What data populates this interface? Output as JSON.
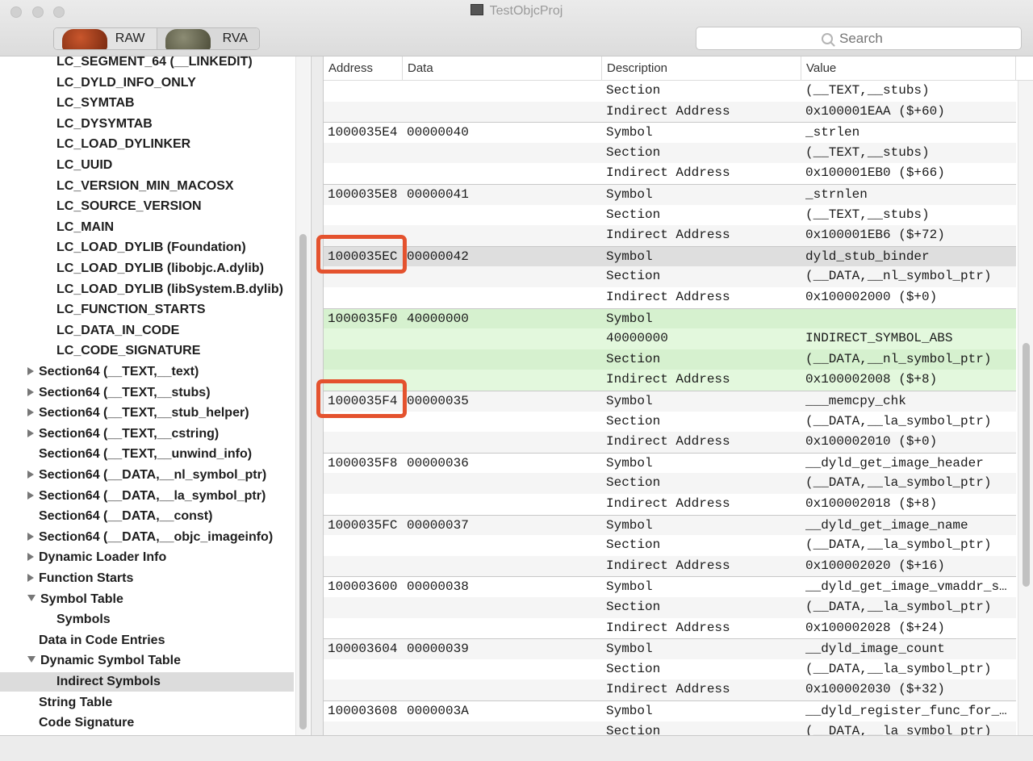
{
  "window": {
    "title": "TestObjcProj"
  },
  "toolbar": {
    "raw_label": "RAW",
    "rva_label": "RVA",
    "search_placeholder": "Search"
  },
  "sidebar": {
    "items": [
      {
        "label": "LC_SEGMENT_64 (__LINKEDIT)",
        "level": 2,
        "expand": "none"
      },
      {
        "label": "LC_DYLD_INFO_ONLY",
        "level": 2,
        "expand": "none"
      },
      {
        "label": "LC_SYMTAB",
        "level": 2,
        "expand": "none"
      },
      {
        "label": "LC_DYSYMTAB",
        "level": 2,
        "expand": "none"
      },
      {
        "label": "LC_LOAD_DYLINKER",
        "level": 2,
        "expand": "none"
      },
      {
        "label": "LC_UUID",
        "level": 2,
        "expand": "none"
      },
      {
        "label": "LC_VERSION_MIN_MACOSX",
        "level": 2,
        "expand": "none"
      },
      {
        "label": "LC_SOURCE_VERSION",
        "level": 2,
        "expand": "none"
      },
      {
        "label": "LC_MAIN",
        "level": 2,
        "expand": "none"
      },
      {
        "label": "LC_LOAD_DYLIB (Foundation)",
        "level": 2,
        "expand": "none"
      },
      {
        "label": "LC_LOAD_DYLIB (libobjc.A.dylib)",
        "level": 2,
        "expand": "none"
      },
      {
        "label": "LC_LOAD_DYLIB (libSystem.B.dylib)",
        "level": 2,
        "expand": "none"
      },
      {
        "label": "LC_FUNCTION_STARTS",
        "level": 2,
        "expand": "none"
      },
      {
        "label": "LC_DATA_IN_CODE",
        "level": 2,
        "expand": "none"
      },
      {
        "label": "LC_CODE_SIGNATURE",
        "level": 2,
        "expand": "none"
      },
      {
        "label": "Section64 (__TEXT,__text)",
        "level": 1,
        "expand": "closed"
      },
      {
        "label": "Section64 (__TEXT,__stubs)",
        "level": 1,
        "expand": "closed"
      },
      {
        "label": "Section64 (__TEXT,__stub_helper)",
        "level": 1,
        "expand": "closed"
      },
      {
        "label": "Section64 (__TEXT,__cstring)",
        "level": 1,
        "expand": "closed"
      },
      {
        "label": "Section64 (__TEXT,__unwind_info)",
        "level": 1,
        "expand": "none"
      },
      {
        "label": "Section64 (__DATA,__nl_symbol_ptr)",
        "level": 1,
        "expand": "closed"
      },
      {
        "label": "Section64 (__DATA,__la_symbol_ptr)",
        "level": 1,
        "expand": "closed"
      },
      {
        "label": "Section64 (__DATA,__const)",
        "level": 1,
        "expand": "none"
      },
      {
        "label": "Section64 (__DATA,__objc_imageinfo)",
        "level": 1,
        "expand": "closed"
      },
      {
        "label": "Dynamic Loader Info",
        "level": 1,
        "expand": "closed"
      },
      {
        "label": "Function Starts",
        "level": 1,
        "expand": "closed"
      },
      {
        "label": "Symbol Table",
        "level": 1,
        "expand": "open"
      },
      {
        "label": "Symbols",
        "level": 2,
        "expand": "none"
      },
      {
        "label": "Data in Code Entries",
        "level": 1,
        "expand": "none"
      },
      {
        "label": "Dynamic Symbol Table",
        "level": 1,
        "expand": "open"
      },
      {
        "label": "Indirect Symbols",
        "level": 2,
        "expand": "none",
        "selected": true
      },
      {
        "label": "String Table",
        "level": 1,
        "expand": "none"
      },
      {
        "label": "Code Signature",
        "level": 1,
        "expand": "none"
      }
    ]
  },
  "table": {
    "columns": [
      "Address",
      "Data",
      "Description",
      "Value"
    ],
    "rows": [
      {
        "addr": "",
        "data": "",
        "desc": "Section",
        "val": "(__TEXT,__stubs)"
      },
      {
        "addr": "",
        "data": "",
        "desc": "Indirect Address",
        "val": "0x100001EAA ($+60)"
      },
      {
        "addr": "1000035E4",
        "data": "00000040",
        "desc": "Symbol",
        "val": "_strlen",
        "top": true
      },
      {
        "addr": "",
        "data": "",
        "desc": "Section",
        "val": "(__TEXT,__stubs)"
      },
      {
        "addr": "",
        "data": "",
        "desc": "Indirect Address",
        "val": "0x100001EB0 ($+66)"
      },
      {
        "addr": "1000035E8",
        "data": "00000041",
        "desc": "Symbol",
        "val": "_strnlen",
        "top": true
      },
      {
        "addr": "",
        "data": "",
        "desc": "Section",
        "val": "(__TEXT,__stubs)"
      },
      {
        "addr": "",
        "data": "",
        "desc": "Indirect Address",
        "val": "0x100001EB6 ($+72)"
      },
      {
        "addr": "1000035EC",
        "data": "00000042",
        "desc": "Symbol",
        "val": "dyld_stub_binder",
        "top": true,
        "hl": true
      },
      {
        "addr": "",
        "data": "",
        "desc": "Section",
        "val": "(__DATA,__nl_symbol_ptr)"
      },
      {
        "addr": "",
        "data": "",
        "desc": "Indirect Address",
        "val": "0x100002000 ($+0)"
      },
      {
        "addr": "1000035F0",
        "data": "40000000",
        "desc": "Symbol",
        "val": "",
        "top": true,
        "green": true
      },
      {
        "addr": "",
        "data": "",
        "desc": "40000000",
        "val": "INDIRECT_SYMBOL_ABS",
        "green": true
      },
      {
        "addr": "",
        "data": "",
        "desc": "Section",
        "val": "(__DATA,__nl_symbol_ptr)",
        "green": true
      },
      {
        "addr": "",
        "data": "",
        "desc": "Indirect Address",
        "val": "0x100002008 ($+8)",
        "green": true
      },
      {
        "addr": "1000035F4",
        "data": "00000035",
        "desc": "Symbol",
        "val": "___memcpy_chk",
        "top": true
      },
      {
        "addr": "",
        "data": "",
        "desc": "Section",
        "val": "(__DATA,__la_symbol_ptr)"
      },
      {
        "addr": "",
        "data": "",
        "desc": "Indirect Address",
        "val": "0x100002010 ($+0)"
      },
      {
        "addr": "1000035F8",
        "data": "00000036",
        "desc": "Symbol",
        "val": "__dyld_get_image_header",
        "top": true
      },
      {
        "addr": "",
        "data": "",
        "desc": "Section",
        "val": "(__DATA,__la_symbol_ptr)"
      },
      {
        "addr": "",
        "data": "",
        "desc": "Indirect Address",
        "val": "0x100002018 ($+8)"
      },
      {
        "addr": "1000035FC",
        "data": "00000037",
        "desc": "Symbol",
        "val": "__dyld_get_image_name",
        "top": true
      },
      {
        "addr": "",
        "data": "",
        "desc": "Section",
        "val": "(__DATA,__la_symbol_ptr)"
      },
      {
        "addr": "",
        "data": "",
        "desc": "Indirect Address",
        "val": "0x100002020 ($+16)"
      },
      {
        "addr": "100003600",
        "data": "00000038",
        "desc": "Symbol",
        "val": "__dyld_get_image_vmaddr_s…",
        "top": true
      },
      {
        "addr": "",
        "data": "",
        "desc": "Section",
        "val": "(__DATA,__la_symbol_ptr)"
      },
      {
        "addr": "",
        "data": "",
        "desc": "Indirect Address",
        "val": "0x100002028 ($+24)"
      },
      {
        "addr": "100003604",
        "data": "00000039",
        "desc": "Symbol",
        "val": "__dyld_image_count",
        "top": true
      },
      {
        "addr": "",
        "data": "",
        "desc": "Section",
        "val": "(__DATA,__la_symbol_ptr)"
      },
      {
        "addr": "",
        "data": "",
        "desc": "Indirect Address",
        "val": "0x100002030 ($+32)"
      },
      {
        "addr": "100003608",
        "data": "0000003A",
        "desc": "Symbol",
        "val": "__dyld_register_func_for_…",
        "top": true
      },
      {
        "addr": "",
        "data": "",
        "desc": "Section",
        "val": "(__DATA,__la_symbol_ptr)"
      }
    ]
  },
  "annotations": {
    "color": "#e4522e"
  }
}
